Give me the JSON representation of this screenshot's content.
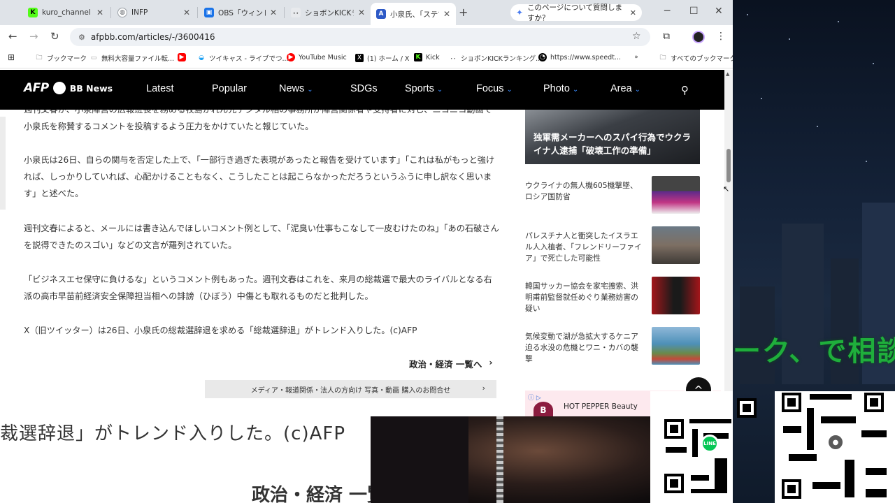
{
  "tabs": [
    {
      "label": "kuro_channel",
      "fav_color": "#53fc18",
      "fav_text": "K"
    },
    {
      "label": "INFP",
      "fav_color": "#9aa0a6",
      "fav_text": "◍"
    },
    {
      "label": "OBS「ウィンドウ",
      "fav_color": "#1a73e8",
      "fav_text": "▣"
    },
    {
      "label": "ショボンKICKラン",
      "fav_color": "#e8eaed",
      "fav_text": "･･"
    },
    {
      "label": "小泉氏、「ステマ",
      "fav_color": "#2d59c6",
      "fav_text": "A"
    }
  ],
  "gemini_tab": {
    "label": "このページについて質問しますか？"
  },
  "address": {
    "url": "afpbb.com/articles/-/3600416"
  },
  "bookmarks": [
    {
      "label": "ブックマーク",
      "icon": "folder-icon"
    },
    {
      "label": "無料大容量ファイル転...",
      "icon": "transfer-icon"
    },
    {
      "label": "",
      "icon": "youtube-icon"
    },
    {
      "label": "ツイキャス - ライブでつ...",
      "icon": "twitcasting-icon"
    },
    {
      "label": "YouTube Music",
      "icon": "youtube-music-icon"
    },
    {
      "label": "(1) ホーム / X",
      "icon": "x-icon"
    },
    {
      "label": "Kick",
      "icon": "kick-icon"
    },
    {
      "label": "ショボンKICKランキング...",
      "icon": "shobon-icon"
    },
    {
      "label": "https://www.speedt...",
      "icon": "speedtest-icon"
    },
    {
      "label": "すべてのブックマーク",
      "icon": "folder-icon"
    }
  ],
  "afp": {
    "logo_afp": "AFP",
    "logo_bb": "BB News",
    "nav": [
      {
        "label": "Latest",
        "dropdown": false
      },
      {
        "label": "Popular",
        "dropdown": false
      },
      {
        "label": "News",
        "dropdown": true
      },
      {
        "label": "SDGs",
        "dropdown": false
      },
      {
        "label": "Sports",
        "dropdown": true
      },
      {
        "label": "Focus",
        "dropdown": true
      },
      {
        "label": "Photo",
        "dropdown": true
      },
      {
        "label": "Area",
        "dropdown": true
      }
    ]
  },
  "article": {
    "p0": "週刊文春が、小泉陣営の広報班長を務める牧島かれん元デジタル相の事務所が陣営関係者や支持者に対し、ニコニコ動画で小泉氏を称賛するコメントを投稿するよう圧力をかけていたと報じていた。",
    "p1": "小泉氏は26日、自らの関与を否定した上で、「一部行き過ぎた表現があったと報告を受けています」「これは私がもっと強ければ、しっかりしていれば、心配かけることもなく、こうしたことは起こらなかっただろうというふうに申し訳なく思います」と述べた。",
    "p2": "週刊文春によると、メールには書き込んでほしいコメント例として、「泥臭い仕事もこなして一皮むけたのね」「あの石破さんを説得できたのスゴい」などの文言が羅列されていた。",
    "p3": "「ビジネスエセ保守に負けるな」というコメント例もあった。週刊文春はこれを、来月の総裁選で最大のライバルとなる右派の高市早苗前経済安全保障担当相への誹謗（ひぼう）中傷とも取れるものだと批判した。",
    "p4": "X（旧ツイッター）は26日、小泉氏の総裁選辞退を求める「総裁選辞退」がトレンド入りした。(c)AFP",
    "more_link": "政治・経済 一覧へ",
    "media_bar": "メディア・報道関係・法人の方向け 写真・動画 購入のお問合せ"
  },
  "sidebar": {
    "featured_caption": "独軍需メーカーへのスパイ行為でウクライナ人逮捕「破壊工作の準備」",
    "items": [
      {
        "text": "ウクライナの無人機605機撃墜、ロシア国防省",
        "thumb": "#5b2a8a"
      },
      {
        "text": "パレスチナ人と衝突したイスラエル人入植者、「フレンドリーファイア」で死亡した可能性",
        "thumb": "#7d6f63"
      },
      {
        "text": "韓国サッカー協会を家宅捜索、洪明甫前監督就任めぐり業務妨害の疑い",
        "thumb": "#a4161a"
      },
      {
        "text": "気候変動で湖が急拡大するケニア 迫る水没の危機とワニ・カバの襲撃",
        "thumb": "#4d90b8"
      }
    ],
    "ad_label": "HOT PEPPER Beauty"
  },
  "overlay": {
    "zoom_line1": "裁選辞退」がトレンド入りした。(c)AFP",
    "zoom_line2": "政治・経済 一覧",
    "desktop_text": "ーク、で相談"
  }
}
